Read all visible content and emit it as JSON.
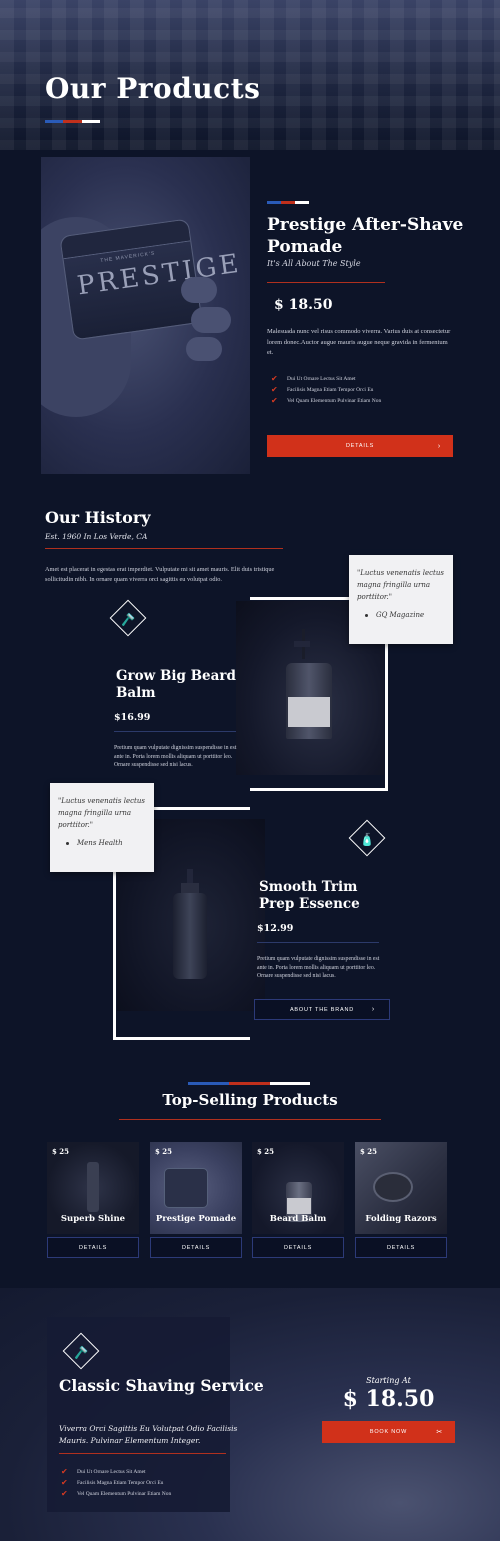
{
  "hero": {
    "title": "Our Products"
  },
  "colors": {
    "blue": "#2a5bb8",
    "red": "#c0301c",
    "white": "#ffffff",
    "navy": "#0d1428",
    "accent_red": "#d1311a"
  },
  "feature": {
    "image_label": "PRESTIGE",
    "image_label_top": "THE MAVERICK'S",
    "title": "Prestige After-Shave Pomade",
    "subtitle": "It's All About The Style",
    "price": "$ 18.50",
    "description": "Malesuada nunc vel risus commodo viverra. Varius duis at consectetur lorem donec.Auctor augue mauris augue neque gravida in fermentum et.",
    "checks": [
      "Dui Ut Ornare Lectus Sit Amet",
      "Facilisis Magna Etiam Tempor Orci Eu",
      "Vel Quam Elementum Pulvinar Etiam Non"
    ],
    "button": "DETAILS",
    "button_icon": "chevron-right-icon"
  },
  "history": {
    "title": "Our History",
    "subtitle": "Est. 1960 In Los Verde, CA",
    "description": "Amet est placerat in egestas erat imperdiet. Vulputate mi sit amet mauris. Elit duis tristique sollicitudin nibh. In ornare quam viverra orci sagittis eu volutpat odio.",
    "products": [
      {
        "name": "Grow Big Beard Balm",
        "price": "$16.99",
        "description": "Pretium quam vulputate dignissim suspendisse in est ante in. Porta lorem mollis aliquam ut porttitor leo. Ornare suspendisse sed nisi lacus.",
        "icon": "razor-icon",
        "quote": "\"Luctus venenatis lectus magna fringilla urna porttitor.\"",
        "quote_source": "GQ Magazine"
      },
      {
        "name": "Smooth Trim Prep Essence",
        "price": "$12.99",
        "description": "Pretium quam vulputate dignissim suspendisse in est ante in. Porta lorem mollis aliquam ut porttitor leo. Ornare suspendisse sed nisi lacus.",
        "icon": "shaving-brush-icon",
        "quote": "\"Luctus venenatis lectus magna fringilla urna porttitor.\"",
        "quote_source": "Mens Health",
        "button": "ABOUT THE BRAND"
      }
    ]
  },
  "top_selling": {
    "title": "Top-Selling Products",
    "items": [
      {
        "price": "$ 25",
        "name": "Superb Shine",
        "button": "DETAILS"
      },
      {
        "price": "$ 25",
        "name": "Prestige Pomade",
        "button": "DETAILS"
      },
      {
        "price": "$ 25",
        "name": "Beard Balm",
        "button": "DETAILS"
      },
      {
        "price": "$ 25",
        "name": "Folding Razors",
        "button": "DETAILS"
      }
    ]
  },
  "service": {
    "title": "Classic Shaving Service",
    "subtitle": "Viverra Orci Sagittis Eu Volutpat Odio Facilisis Mauris. Pulvinar Elementum Integer.",
    "checks": [
      "Dui Ut Ornare Lectus Sit Amet",
      "Facilisis Magna Etiam Tempor Orci Eu",
      "Vel Quam Elementum Pulvinar Etiam Non"
    ],
    "starting_label": "Starting At",
    "price": "$ 18.50",
    "button": "BOOK NOW",
    "button_icon": "scissors-icon",
    "icon": "straight-razor-icon"
  }
}
